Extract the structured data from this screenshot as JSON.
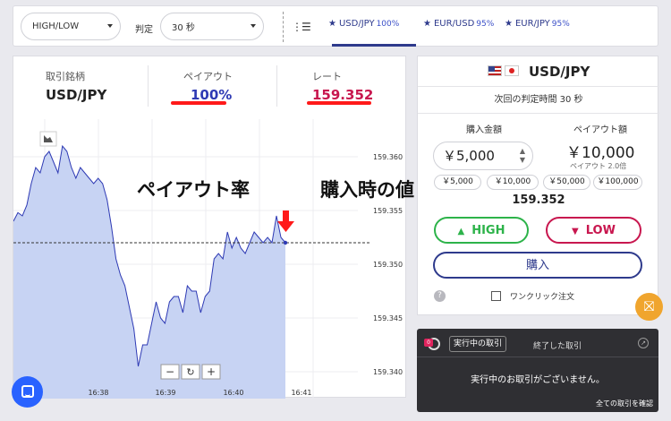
{
  "topbar": {
    "type_select": "HIGH/LOW",
    "judge_label": "判定",
    "judge_select": "30 秒",
    "tabs": [
      {
        "pair": "USD/JPY",
        "payout": "100%",
        "active": true
      },
      {
        "pair": "EUR/USD",
        "payout": "95%",
        "active": false
      },
      {
        "pair": "EUR/JPY",
        "payout": "95%",
        "active": false
      }
    ]
  },
  "stats": {
    "symbol_label": "取引銘柄",
    "symbol_value": "USD/JPY",
    "payout_label": "ペイアウト",
    "payout_value": "100%",
    "rate_label": "レート",
    "rate_value": "159.352"
  },
  "annotations": {
    "payout_rate": "ペイアウト率",
    "purchase_value": "購入時の値"
  },
  "chart_data": {
    "type": "area",
    "x_tick_labels": [
      "16:38",
      "16:39",
      "16:40",
      "16:41"
    ],
    "y_tick_labels": [
      "159.360",
      "159.355",
      "159.350",
      "159.345",
      "159.340"
    ],
    "ylim": [
      159.3375,
      159.3635
    ],
    "x": [
      0,
      5,
      10,
      15,
      20,
      25,
      30,
      35,
      40,
      45,
      50,
      55,
      60,
      65,
      70,
      75,
      80,
      85,
      90,
      95,
      100,
      105,
      110,
      115,
      120,
      125,
      130,
      135,
      140,
      145,
      150,
      155,
      160,
      165,
      170,
      175,
      180,
      185,
      190,
      195,
      200,
      205,
      210,
      215,
      220,
      225,
      230,
      235,
      240,
      245,
      250,
      255,
      260,
      265,
      270,
      275,
      280,
      285,
      290,
      295,
      300,
      305
    ],
    "values": [
      159.354,
      159.3548,
      159.3545,
      159.3555,
      159.3575,
      159.359,
      159.3585,
      159.36,
      159.3605,
      159.3595,
      159.3585,
      159.361,
      159.3605,
      159.359,
      159.358,
      159.359,
      159.3585,
      159.358,
      159.3575,
      159.358,
      159.3575,
      159.356,
      159.3535,
      159.3505,
      159.349,
      159.348,
      159.346,
      159.344,
      159.3405,
      159.3425,
      159.3425,
      159.3445,
      159.3465,
      159.345,
      159.3445,
      159.3465,
      159.347,
      159.347,
      159.3455,
      159.348,
      159.3475,
      159.3475,
      159.3455,
      159.347,
      159.3475,
      159.3505,
      159.351,
      159.3505,
      159.353,
      159.3515,
      159.3525,
      159.3515,
      159.351,
      159.352,
      159.353,
      159.3525,
      159.352,
      159.3525,
      159.352,
      159.3545,
      159.3525,
      159.352
    ],
    "reference_line": 159.352,
    "grid": true
  },
  "panel": {
    "pair": "USD/JPY",
    "next_judge": "次回の判定時間 30 秒",
    "amount_label": "購入金額",
    "amount_value": "￥5,000",
    "payout_amount_label": "ペイアウト額",
    "payout_amount": "￥10,000",
    "payout_multiplier": "ペイアウト 2.0倍",
    "chips": [
      "￥5,000",
      "￥10,000",
      "￥50,000",
      "￥100,000"
    ],
    "rate": "159.352",
    "high_label": "HIGH",
    "low_label": "LOW",
    "buy_label": "購入",
    "oneclick_label": "ワンクリック注文",
    "help": "?"
  },
  "trades": {
    "badge": "0",
    "active_tab": "実行中の取引",
    "ended_tab": "終了した取引",
    "empty_msg": "実行中のお取引がございません。",
    "all_link": "全ての取引を確認"
  },
  "colors": {
    "accent": "#2e3a8c",
    "high": "#2db34a",
    "low": "#c8174f",
    "rate": "#c8174f",
    "payout": "#2e3ab4",
    "underline": "#ff1a1a",
    "area_fill": "#c7d3f3",
    "line": "#2e3ab4"
  }
}
